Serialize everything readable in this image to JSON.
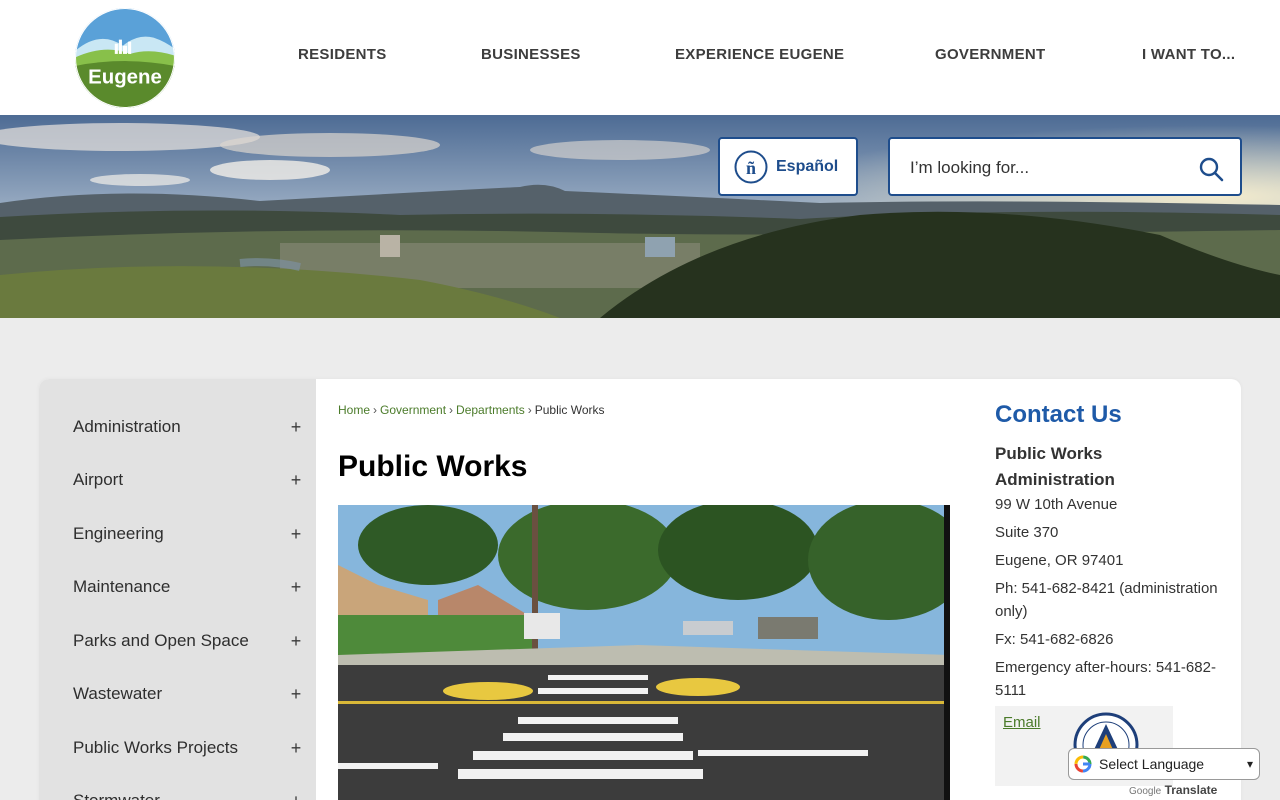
{
  "header": {
    "logo_text": "Eugene",
    "nav": [
      {
        "label": "RESIDENTS"
      },
      {
        "label": "BUSINESSES"
      },
      {
        "label": "EXPERIENCE EUGENE"
      },
      {
        "label": "GOVERNMENT"
      },
      {
        "label": "I WANT TO..."
      }
    ]
  },
  "hero": {
    "espanol_label": "Español",
    "search_placeholder": "I’m looking for..."
  },
  "sidebar": {
    "items": [
      {
        "label": "Administration",
        "expand": "+"
      },
      {
        "label": "Airport",
        "expand": "+"
      },
      {
        "label": "Engineering",
        "expand": "+"
      },
      {
        "label": "Maintenance",
        "expand": "+"
      },
      {
        "label": "Parks and Open Space",
        "expand": "+"
      },
      {
        "label": "Wastewater",
        "expand": "+"
      },
      {
        "label": "Public Works Projects",
        "expand": "+"
      },
      {
        "label": "Stormwater",
        "expand": "+"
      }
    ]
  },
  "breadcrumb": {
    "home": "Home",
    "government": "Government",
    "departments": "Departments",
    "current": "Public Works",
    "separator": "›"
  },
  "main": {
    "title": "Public Works"
  },
  "contact": {
    "title": "Contact Us",
    "org": "Public Works Administration",
    "address1": "99 W 10th Avenue",
    "address2": "Suite 370",
    "city": "Eugene, OR 97401",
    "phone": "Ph: 541-682-8421 (administration only)",
    "fax": "Fx: 541-682-6826",
    "emergency": "Emergency after-hours: 541-682-5111",
    "email_label": "Email"
  },
  "translate": {
    "select_label": "Select Language",
    "powered_google": "Google",
    "powered_translate": "Translate"
  },
  "colors": {
    "brand_blue": "#1e4d8c",
    "link_green": "#4b7b2a",
    "contact_blue": "#1e5aa8"
  }
}
